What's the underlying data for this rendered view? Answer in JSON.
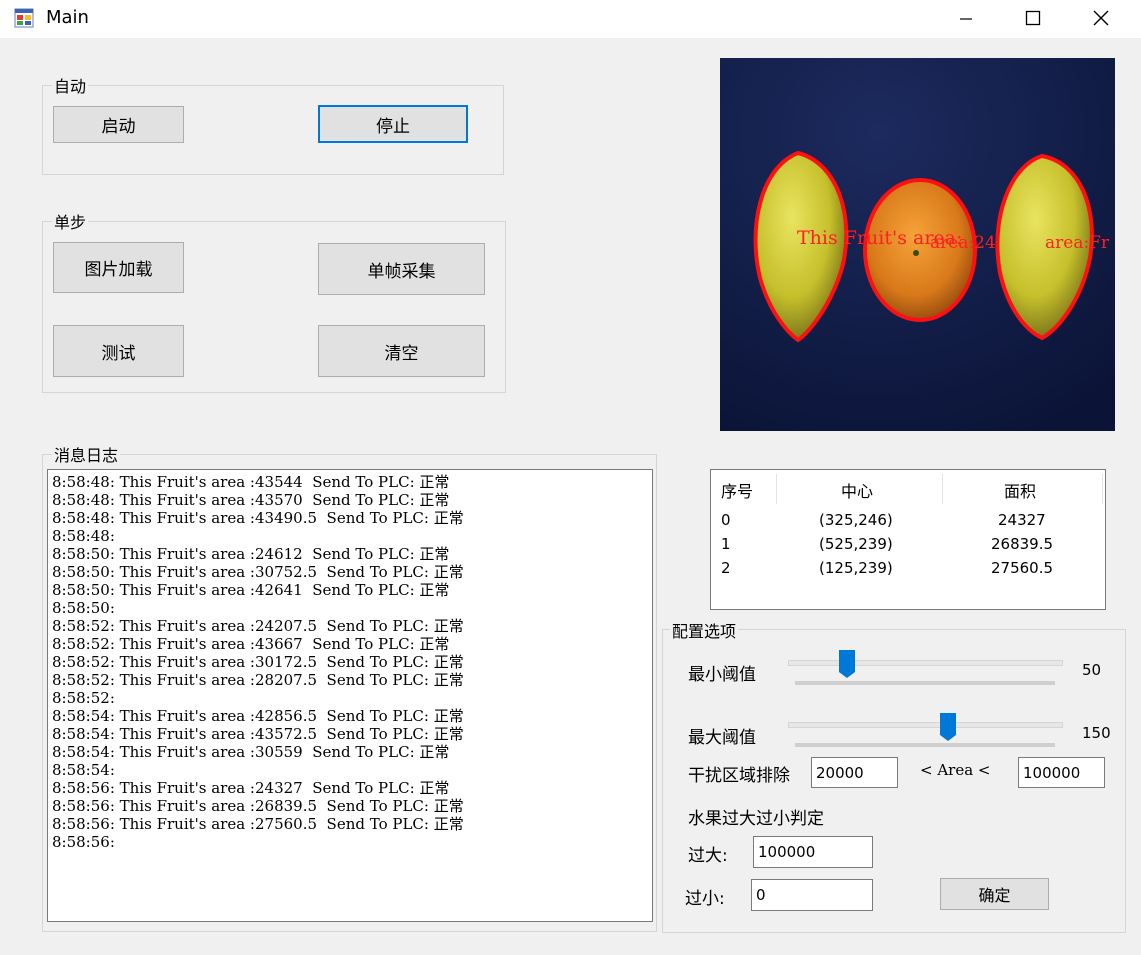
{
  "window": {
    "title": "Main"
  },
  "auto_group": {
    "label": "自动",
    "start_label": "启动",
    "stop_label": "停止"
  },
  "step_group": {
    "label": "单步",
    "load_image_label": "图片加载",
    "single_frame_label": "单帧采集",
    "test_label": "测试",
    "clear_label": "清空"
  },
  "log_group": {
    "label": "消息日志",
    "lines": [
      "8:58:48: This Fruit's area :43544  Send To PLC: 正常",
      "8:58:48: This Fruit's area :43570  Send To PLC: 正常",
      "8:58:48: This Fruit's area :43490.5  Send To PLC: 正常",
      "8:58:48:",
      "8:58:50: This Fruit's area :24612  Send To PLC: 正常",
      "8:58:50: This Fruit's area :30752.5  Send To PLC: 正常",
      "8:58:50: This Fruit's area :42641  Send To PLC: 正常",
      "8:58:50:",
      "8:58:52: This Fruit's area :24207.5  Send To PLC: 正常",
      "8:58:52: This Fruit's area :43667  Send To PLC: 正常",
      "8:58:52: This Fruit's area :30172.5  Send To PLC: 正常",
      "8:58:52: This Fruit's area :28207.5  Send To PLC: 正常",
      "8:58:52:",
      "8:58:54: This Fruit's area :42856.5  Send To PLC: 正常",
      "8:58:54: This Fruit's area :43572.5  Send To PLC: 正常",
      "8:58:54: This Fruit's area :30559  Send To PLC: 正常",
      "8:58:54:",
      "8:58:56: This Fruit's area :24327  Send To PLC: 正常",
      "8:58:56: This Fruit's area :26839.5  Send To PLC: 正常",
      "8:58:56: This Fruit's area :27560.5  Send To PLC: 正常",
      "8:58:56:"
    ]
  },
  "image_overlay": {
    "text_left": "This Fruit's area:",
    "text_mid": "area:24",
    "text_right": "area:Fr"
  },
  "results_table": {
    "headers": [
      "序号",
      "中心",
      "面积"
    ],
    "rows": [
      [
        "0",
        "(325,246)",
        "24327"
      ],
      [
        "1",
        "(525,239)",
        "26839.5"
      ],
      [
        "2",
        "(125,239)",
        "27560.5"
      ]
    ]
  },
  "config_group": {
    "label": "配置选项",
    "min_threshold_label": "最小阈值",
    "min_threshold_value": "50",
    "min_threshold_fraction": 0.196,
    "max_threshold_label": "最大阈值",
    "max_threshold_value": "150",
    "max_threshold_fraction": 0.588,
    "interference_label": "干扰区域排除",
    "area_low": "20000",
    "area_text": "< Area <",
    "area_high": "100000",
    "size_judge_label": "水果过大过小判定",
    "too_big_label": "过大:",
    "too_big_value": "100000",
    "too_small_label": "过小:",
    "too_small_value": "0",
    "confirm_label": "确定"
  },
  "colors": {
    "accent": "#0078d7",
    "contour": "#ff0000",
    "image_bg": "#101a42"
  }
}
